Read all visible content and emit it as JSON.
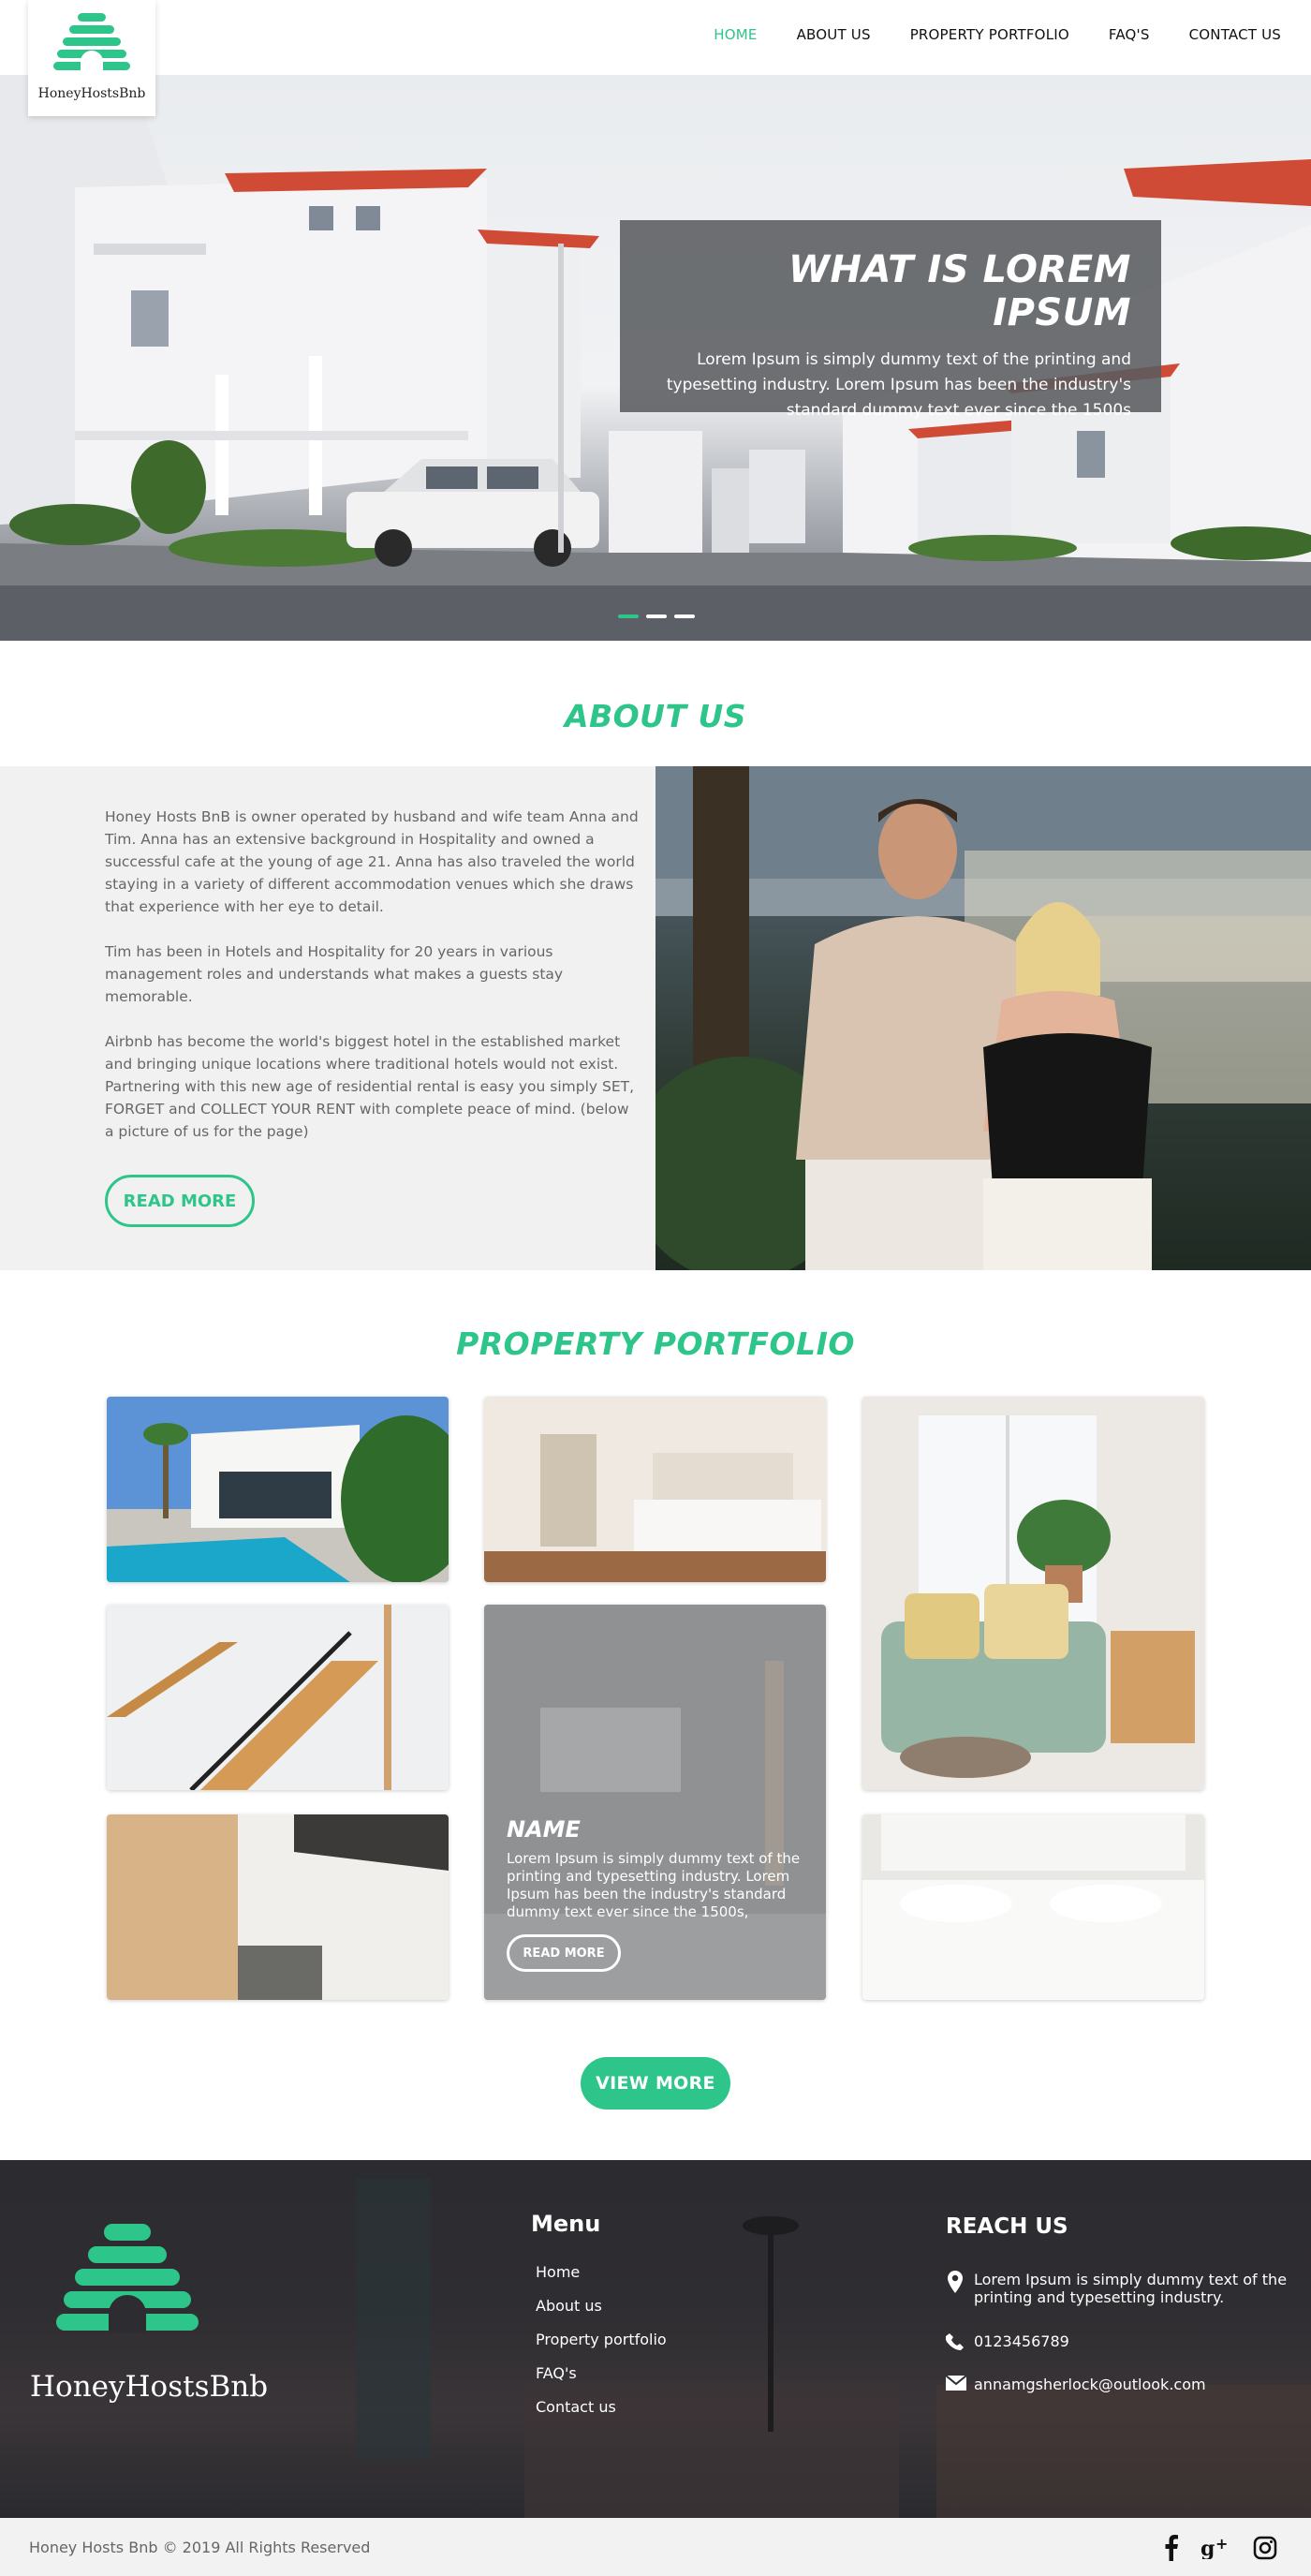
{
  "brand": {
    "name": "HoneyHostsBnb",
    "accent": "#2ec58a"
  },
  "nav": {
    "items": [
      {
        "label": "HOME",
        "active": true
      },
      {
        "label": "ABOUT US"
      },
      {
        "label": "PROPERTY PORTFOLIO"
      },
      {
        "label": "FAQ'S"
      },
      {
        "label": "CONTACT US"
      }
    ]
  },
  "hero": {
    "title": "WHAT IS LOREM IPSUM",
    "text": "Lorem Ipsum is simply dummy text of the printing and typesetting industry. Lorem Ipsum has been the industry's standard dummy text ever since the 1500s",
    "slides": 3,
    "active_slide": 1
  },
  "about": {
    "title": "ABOUT US",
    "paragraphs": [
      "Honey Hosts BnB is owner operated by husband and wife team Anna and Tim. Anna has an extensive background in Hospitality and owned a successful cafe at the young of age 21. Anna has also traveled the world staying in a variety of different accommodation venues which she draws that experience with her eye to detail.",
      "Tim has been in Hotels and Hospitality for 20 years in various management roles and understands what makes a guests stay memorable.",
      "Airbnb has become the world's biggest hotel in the established market and bringing unique locations where traditional hotels would not exist. Partnering with this new age of residential rental is easy you simply SET, FORGET and COLLECT YOUR RENT with complete peace of mind. (below a picture of us for the page)"
    ],
    "button": "READ MORE"
  },
  "portfolio": {
    "title": "PROPERTY PORTFOLIO",
    "featured": {
      "name": "NAME",
      "text": "Lorem Ipsum is simply dummy text of the printing and typesetting industry. Lorem Ipsum has been the industry's standard dummy text ever since the 1500s,",
      "button": "READ MORE"
    },
    "view_more": "VIEW MORE"
  },
  "footer": {
    "logo_text": "HoneyHostsBnb",
    "menu_title": "Menu",
    "menu": [
      "Home",
      "About us",
      "Property portfolio",
      "FAQ's",
      "Contact us"
    ],
    "reach_title": "REACH US",
    "address": "Lorem Ipsum is simply dummy text of the printing and typesetting industry.",
    "phone": "0123456789",
    "email": "annamgsherlock@outlook.com",
    "copyright": "Honey Hosts Bnb © 2019 All Rights Reserved",
    "social": [
      "facebook-icon",
      "google-plus-icon",
      "instagram-icon"
    ]
  }
}
